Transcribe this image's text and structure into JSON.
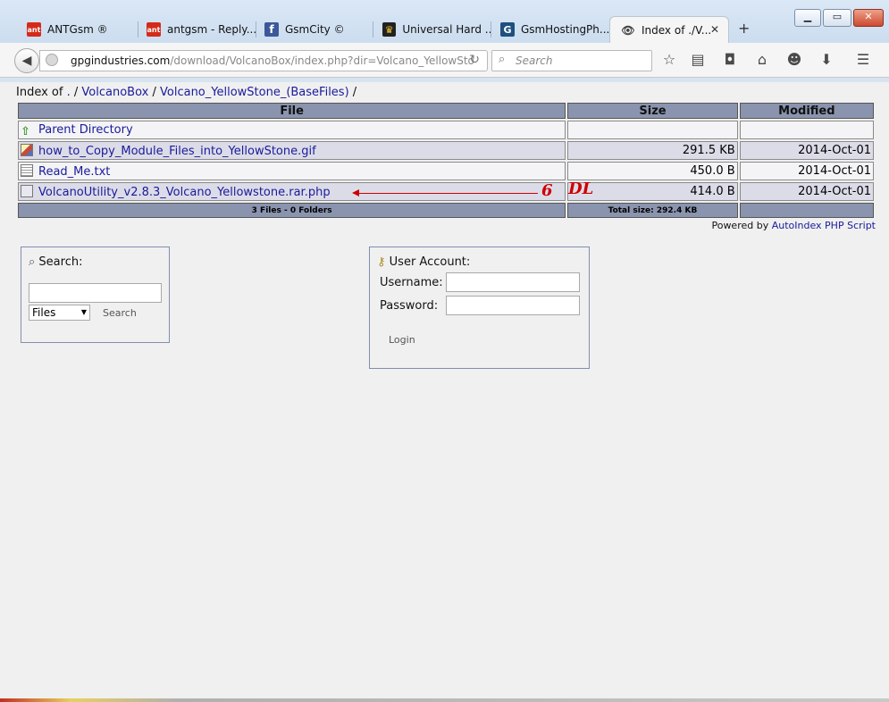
{
  "browser": {
    "tabs": [
      {
        "label": "ANTGsm ®",
        "icon": "ant-logo-icon",
        "icon_text": "ant",
        "color": "#d42a1a"
      },
      {
        "label": "antgsm - Reply...",
        "icon": "ant-logo-icon",
        "icon_text": "ant",
        "color": "#d42a1a"
      },
      {
        "label": "GsmCity ©",
        "icon": "facebook-icon",
        "icon_text": "f",
        "color": "#3b5998"
      },
      {
        "label": "Universal Hard ...",
        "icon": "crown-icon",
        "icon_text": "♛",
        "color": "#222222"
      },
      {
        "label": "GsmHostingPh...",
        "icon": "gsmhosting-icon",
        "icon_text": "G",
        "color": "#1f4f7f"
      },
      {
        "label": "Index of ./V...",
        "icon": "eye-icon",
        "icon_text": "👁",
        "color": "#444444",
        "active": true
      }
    ],
    "url_domain": "gpgindustries.com",
    "url_path": "/download/VolcanoBox/index.php?dir=Volcano_YellowSto",
    "search_placeholder": "Search"
  },
  "page": {
    "crumb_prefix": "Index of",
    "crumbs": [
      ".",
      "VolcanoBox",
      "Volcano_YellowStone_(BaseFiles)"
    ],
    "crumb_sep": "/",
    "headers": {
      "file": "File",
      "size": "Size",
      "modified": "Modified"
    },
    "parent_label": "Parent Directory",
    "files": [
      {
        "name": "how_to_Copy_Module_Files_into_YellowStone.gif",
        "size": "291.5 KB",
        "modified": "2014-Oct-01",
        "icon": "gif-file-icon"
      },
      {
        "name": "Read_Me.txt",
        "size": "450.0  B",
        "modified": "2014-Oct-01",
        "icon": "text-file-icon"
      },
      {
        "name": "VolcanoUtility_v2.8.3_Volcano_Yellowstone.rar.php",
        "size": "414.0  B",
        "modified": "2014-Oct-01",
        "icon": "php-file-icon"
      }
    ],
    "footer_count": "3 Files - 0 Folders",
    "footer_total": "Total size: 292.4 KB",
    "annotation_number": "6",
    "annotation_text": "DL",
    "powered_prefix": "Powered by",
    "powered_link": "AutoIndex PHP Script"
  },
  "search_box": {
    "title": "Search:",
    "select_value": "Files",
    "button": "Search"
  },
  "account_box": {
    "title": "User Account:",
    "username_label": "Username:",
    "password_label": "Password:",
    "button": "Login"
  }
}
